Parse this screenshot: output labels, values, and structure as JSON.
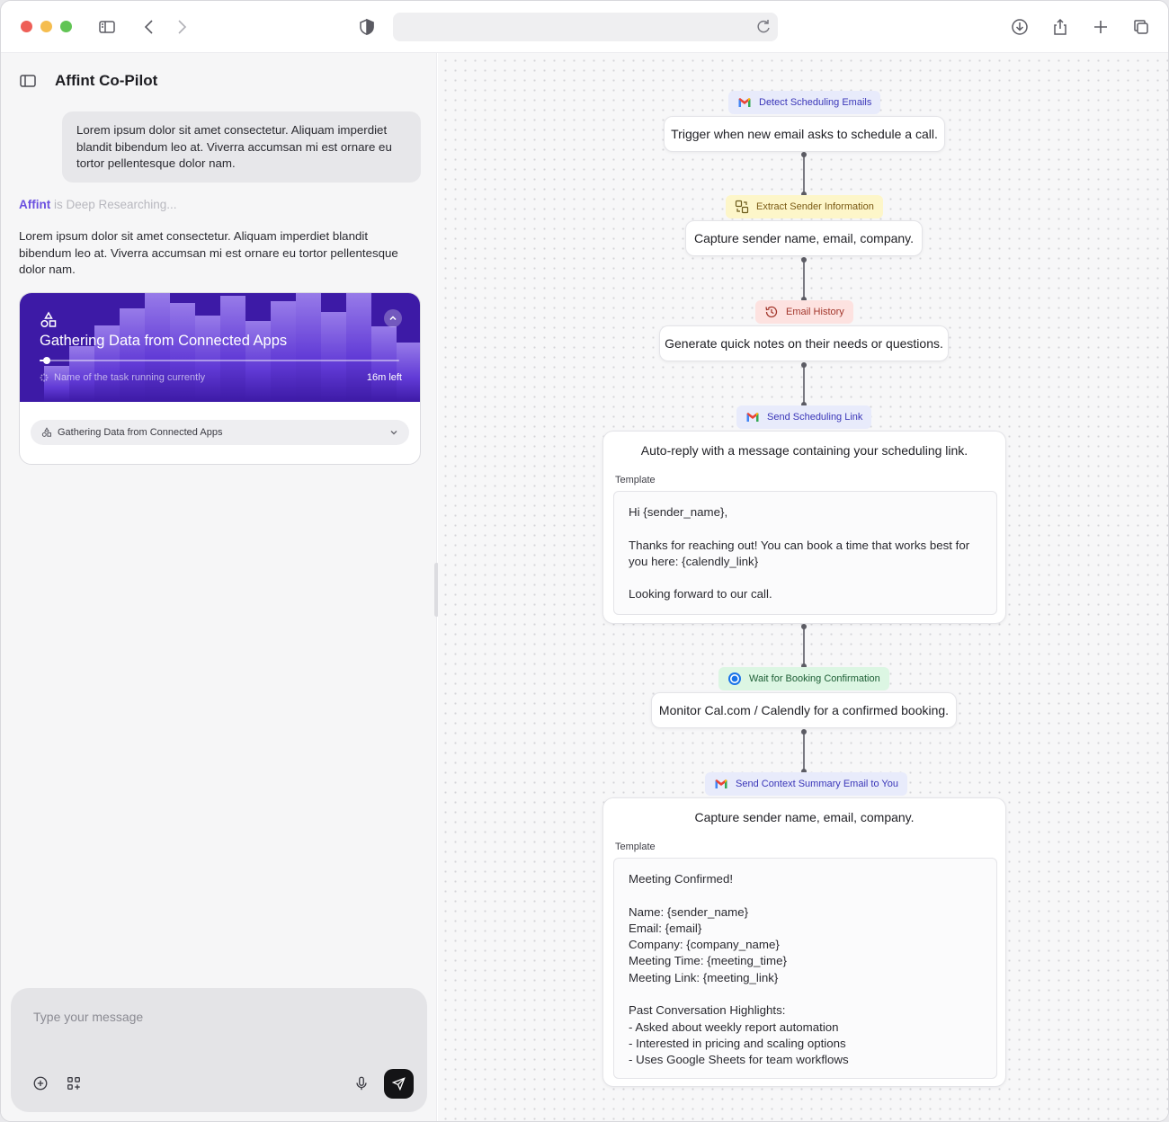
{
  "toolbar": {
    "icons": [
      "sidebar-toggle-icon",
      "back-icon",
      "forward-icon",
      "shield-icon",
      "reload-icon",
      "download-icon",
      "share-icon",
      "new-tab-icon",
      "tabs-overview-icon"
    ]
  },
  "chat": {
    "title": "Affint Co-Pilot",
    "user_message": "Lorem ipsum dolor sit amet consectetur. Aliquam imperdiet blandit bibendum leo at. Viverra accumsan mi est ornare eu tortor pellentesque dolor nam.",
    "status_brand": "Affint",
    "status_text": " is Deep Researching...",
    "ai_message": "Lorem ipsum dolor sit amet consectetur. Aliquam imperdiet blandit bibendum leo at. Viverra accumsan mi est ornare eu tortor pellentesque dolor nam.",
    "task": {
      "title": "Gathering Data from Connected Apps",
      "subtitle": "Name of the task running currently",
      "time_left": "16m left",
      "progress": 0.02,
      "select_label": "Gathering Data from Connected Apps"
    },
    "composer": {
      "placeholder": "Type your message"
    }
  },
  "workflow": {
    "steps": [
      {
        "tag": "Detect Scheduling Emails",
        "tag_icon": "gmail-icon",
        "tag_color": "blue",
        "text": "Trigger when new email asks to schedule a call."
      },
      {
        "tag": "Extract Sender Information",
        "tag_icon": "extract-icon",
        "tag_color": "yellow",
        "text": "Capture sender name, email, company."
      },
      {
        "tag": "Email History",
        "tag_icon": "history-icon",
        "tag_color": "red",
        "text": "Generate quick notes on their needs or questions."
      },
      {
        "tag": "Send Scheduling Link",
        "tag_icon": "gmail-icon",
        "tag_color": "blue",
        "text": "Auto-reply with a message containing your scheduling link.",
        "template_label": "Template",
        "template": "Hi {sender_name},\n\nThanks for reaching out! You can book a time that works best for you here: {calendly_link}\n\nLooking forward to our call."
      },
      {
        "tag": "Wait for Booking Confirmation",
        "tag_icon": "calendly-icon",
        "tag_color": "green",
        "text": "Monitor Cal.com / Calendly for a confirmed booking."
      },
      {
        "tag": "Send Context Summary Email to You",
        "tag_icon": "gmail-icon",
        "tag_color": "blue",
        "text": "Capture sender name, email, company.",
        "template_label": "Template",
        "template": "Meeting Confirmed!\n\nName: {sender_name}\nEmail: {email}\nCompany: {company_name}\nMeeting Time: {meeting_time}\nMeeting Link: {meeting_link}\n\nPast Conversation Highlights:\n- Asked about weekly report automation\n- Interested in pricing and scaling options\n- Uses Google Sheets for team workflows"
      }
    ]
  },
  "colors": {
    "brand": "#6a4fe0",
    "task_hero": "#3d1aa6",
    "traffic_red": "#ee5f57",
    "traffic_yellow": "#f5bd4f",
    "traffic_green": "#61c454"
  }
}
